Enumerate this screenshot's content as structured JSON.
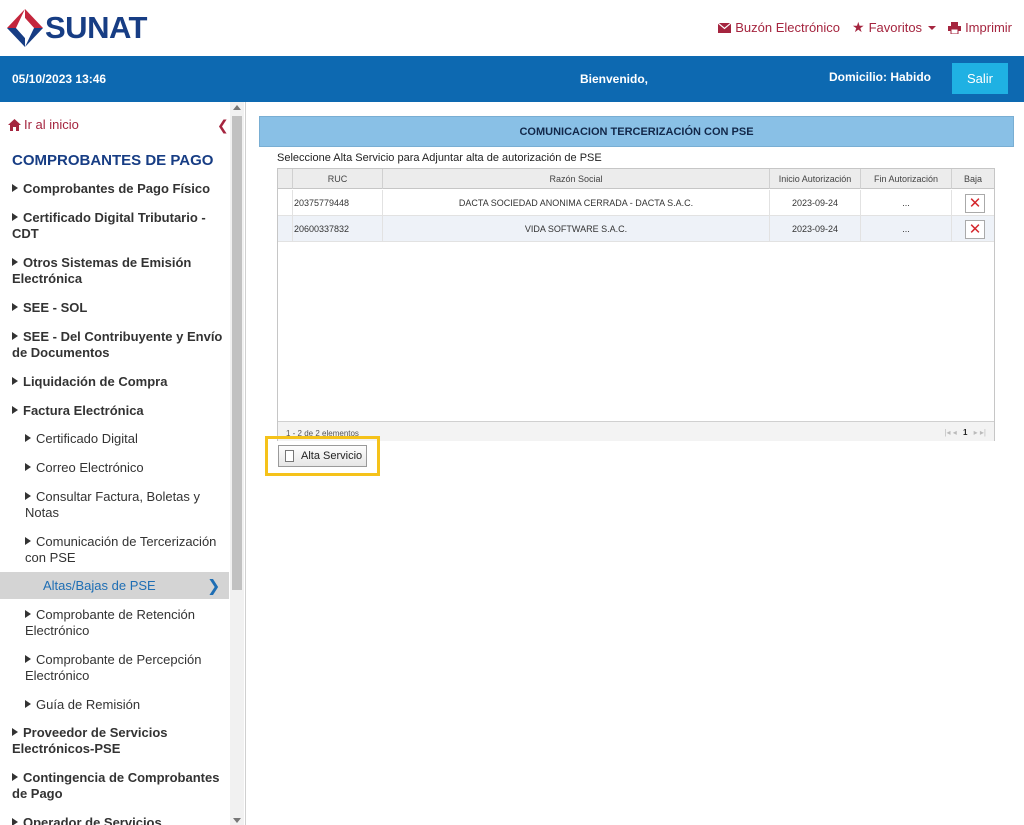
{
  "header": {
    "brand": "SUNAT",
    "links": [
      {
        "label": "Buzón Electrónico",
        "icon": "envelope-icon"
      },
      {
        "label": "Favoritos",
        "icon": "star-icon"
      },
      {
        "label": "Imprimir",
        "icon": "printer-icon"
      }
    ]
  },
  "bar": {
    "datetime": "05/10/2023 13:46",
    "welcome": "Bienvenido,",
    "domicilio": "Domicilio: Habido",
    "logout": "Salir"
  },
  "sidebar": {
    "home": "Ir al inicio",
    "title": "COMPROBANTES DE PAGO",
    "items": [
      "Comprobantes de Pago Físico",
      "Certificado Digital Tributario - CDT",
      "Otros Sistemas de Emisión Electrónica",
      "SEE - SOL",
      "SEE - Del Contribuyente y Envío de Documentos",
      "Liquidación de Compra",
      "Factura Electrónica"
    ],
    "subitems": [
      "Certificado Digital",
      "Correo Electrónico",
      "Consultar Factura, Boletas y Notas",
      "Comunicación de Tercerización con PSE"
    ],
    "active": "Altas/Bajas de PSE",
    "subitems2": [
      "Comprobante de Retención Electrónico",
      "Comprobante de Percepción Electrónico",
      "Guía de Remisión"
    ],
    "items2": [
      "Proveedor de Servicios Electrónicos-PSE",
      "Contingencia de Comprobantes de Pago",
      "Operador de Servicios"
    ]
  },
  "main": {
    "panel_title": "COMUNICACION TERCERIZACIÓN CON PSE",
    "instructions": "Seleccione Alta Servicio para Adjuntar alta de autorización de PSE",
    "columns": [
      "RUC",
      "Razón Social",
      "Inicio Autorización",
      "Fin Autorización",
      "Baja"
    ],
    "rows": [
      {
        "ruc": "20375779448",
        "razon": "DACTA SOCIEDAD ANONIMA CERRADA - DACTA S.A.C.",
        "inicio": "2023-09-24",
        "fin": "...",
        "baja": "✕"
      },
      {
        "ruc": "20600337832",
        "razon": "VIDA SOFTWARE S.A.C.",
        "inicio": "2023-09-24",
        "fin": "...",
        "baja": "✕"
      }
    ],
    "footer_count": "1 - 2 de 2 elementos",
    "current_page": "1",
    "alta_button": "Alta Servicio"
  },
  "colors": {
    "brand_blue": "#173d84",
    "bar_blue": "#0d69b1",
    "accent_red": "#a5253f",
    "button_cyan": "#1fb1e3",
    "highlight": "#f5c21a"
  }
}
